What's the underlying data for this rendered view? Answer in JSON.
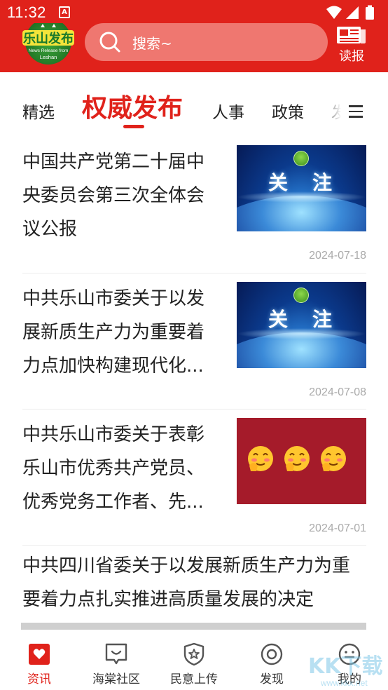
{
  "status_bar": {
    "time": "11:32",
    "notification": "A"
  },
  "header": {
    "logo": {
      "text": "乐山发布",
      "subtext_1": "News Release from",
      "subtext_2": "Leshan"
    },
    "search": {
      "placeholder": "搜索~"
    },
    "read_paper_label": "读报"
  },
  "tabs": [
    {
      "label": "精选",
      "active": false
    },
    {
      "label": "权威发布",
      "active": true
    },
    {
      "label": "人事",
      "active": false
    },
    {
      "label": "政策",
      "active": false
    },
    {
      "label": "发",
      "active": false
    }
  ],
  "articles": [
    {
      "title": "中国共产党第二十届中央委员会第三次全体会议公报",
      "date": "2024-07-18",
      "thumb_words": [
        "关",
        "注"
      ]
    },
    {
      "title": "中共乐山市委关于以发展新质生产力为重要着力点加快构建现代化...",
      "date": "2024-07-08",
      "thumb_words": [
        "关",
        "注"
      ]
    },
    {
      "title": "中共乐山市委关于表彰乐山市优秀共产党员、优秀党务工作者、先...",
      "date": "2024-07-01"
    },
    {
      "title": "中共四川省委关于以发展新质生产力为重要着力点扎实推进高质量发展的决定"
    }
  ],
  "bottom_nav": [
    {
      "label": "资讯",
      "icon": "news-heart-icon",
      "active": true
    },
    {
      "label": "海棠社区",
      "icon": "community-icon",
      "active": false
    },
    {
      "label": "民意上传",
      "icon": "shield-star-icon",
      "active": false
    },
    {
      "label": "发现",
      "icon": "discover-icon",
      "active": false
    },
    {
      "label": "我的",
      "icon": "profile-icon",
      "active": false
    }
  ],
  "watermark": {
    "text": "KK下载",
    "subtext": "www.kkx.net"
  },
  "colors": {
    "brand_red": "#e0221b",
    "search_bg": "#ef7770",
    "date_gray": "#aaaaaa"
  }
}
